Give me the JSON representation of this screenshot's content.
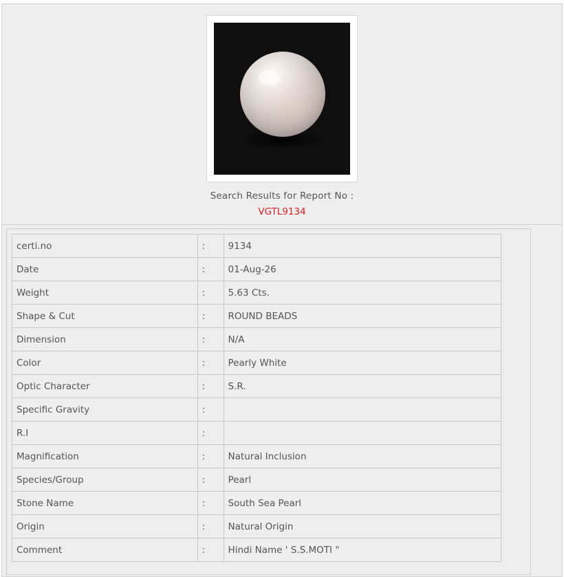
{
  "image": {
    "subject": "pearl-photo"
  },
  "search": {
    "label": "Search Results for Report No :",
    "report_no": "VGTL9134",
    "report_color": "#e02020"
  },
  "separator": ":",
  "rows": [
    {
      "label": "certi.no",
      "value": "9134"
    },
    {
      "label": "Date",
      "value": "01-Aug-26"
    },
    {
      "label": "Weight",
      "value": "5.63 Cts."
    },
    {
      "label": "Shape & Cut",
      "value": "ROUND BEADS"
    },
    {
      "label": "Dimension",
      "value": "N/A"
    },
    {
      "label": "Color",
      "value": "Pearly White"
    },
    {
      "label": "Optic Character",
      "value": "S.R."
    },
    {
      "label": "Specific Gravity",
      "value": ""
    },
    {
      "label": "R.I",
      "value": ""
    },
    {
      "label": "Magnification",
      "value": "Natural Inclusion"
    },
    {
      "label": "Species/Group",
      "value": "Pearl"
    },
    {
      "label": "Stone Name",
      "value": "South Sea Pearl"
    },
    {
      "label": "Origin",
      "value": "Natural Origin"
    },
    {
      "label": "Comment",
      "value": "Hindi Name ' S.S.MOTI \""
    }
  ]
}
